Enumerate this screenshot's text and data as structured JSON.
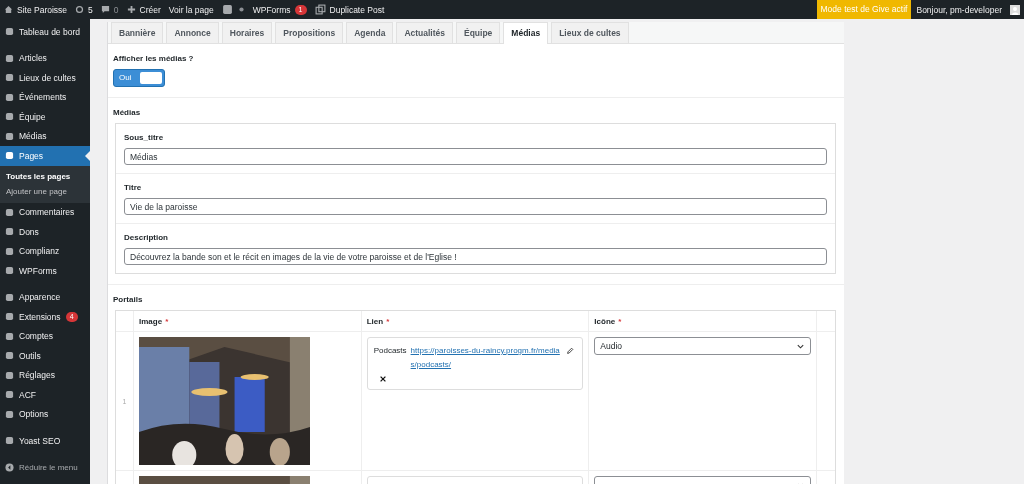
{
  "admin_bar": {
    "site": "Site Paroisse",
    "updates": "5",
    "comments": "0",
    "create": "Créer",
    "view": "Voir la page",
    "wpforms": "WPForms",
    "wpforms_badge": "1",
    "duplicate": "Duplicate Post",
    "give_notice": "Mode test de Give actif",
    "greeting": "Bonjour, pm-developer"
  },
  "sidebar": {
    "groups": [
      [
        {
          "label": "Tableau de bord",
          "selected": false
        }
      ],
      [
        {
          "label": "Articles",
          "selected": false
        },
        {
          "label": "Lieux de cultes",
          "selected": false
        },
        {
          "label": "Événements",
          "selected": false
        },
        {
          "label": "Équipe",
          "selected": false
        },
        {
          "label": "Médias",
          "selected": false
        },
        {
          "label": "Pages",
          "selected": true,
          "children": [
            {
              "label": "Toutes les pages",
              "selected": true
            },
            {
              "label": "Ajouter une page",
              "selected": false
            }
          ]
        },
        {
          "label": "Commentaires",
          "selected": false
        },
        {
          "label": "Dons",
          "selected": false
        },
        {
          "label": "Complianz",
          "selected": false
        },
        {
          "label": "WPForms",
          "selected": false
        }
      ],
      [
        {
          "label": "Apparence",
          "selected": false
        },
        {
          "label": "Extensions",
          "selected": false,
          "badge": "4"
        },
        {
          "label": "Comptes",
          "selected": false
        },
        {
          "label": "Outils",
          "selected": false
        },
        {
          "label": "Réglages",
          "selected": false
        },
        {
          "label": "ACF",
          "selected": false
        },
        {
          "label": "Options",
          "selected": false
        }
      ],
      [
        {
          "label": "Yoast SEO",
          "selected": false
        }
      ]
    ],
    "collapse": "Réduire le menu"
  },
  "tabs": [
    {
      "label": "Bannière",
      "selected": false
    },
    {
      "label": "Annonce",
      "selected": false
    },
    {
      "label": "Horaires",
      "selected": false
    },
    {
      "label": "Propositions",
      "selected": false
    },
    {
      "label": "Agenda",
      "selected": false
    },
    {
      "label": "Actualités",
      "selected": false
    },
    {
      "label": "Équipe",
      "selected": false
    },
    {
      "label": "Médias",
      "selected": true
    },
    {
      "label": "Lieux de cultes",
      "selected": false
    }
  ],
  "show_media": {
    "label": "Afficher les médias ?",
    "on": true,
    "toggle_label": "Oui"
  },
  "media_group": {
    "title": "Médias",
    "fields": [
      {
        "label": "Sous_titre",
        "value": "Médias"
      },
      {
        "label": "Titre",
        "value": "Vie de la paroisse"
      },
      {
        "label": "Description",
        "value": "Découvrez la bande son et le récit en images de la vie de votre paroisse et de l'Eglise !"
      }
    ]
  },
  "portals": {
    "title": "Portails",
    "columns": [
      {
        "label": "Image",
        "required_mark": "*"
      },
      {
        "label": "Lien",
        "required_mark": "*"
      },
      {
        "label": "Icône",
        "required_mark": "*"
      }
    ],
    "rows": [
      {
        "index": "1",
        "image": {
          "kind": "picture"
        },
        "link": {
          "label": "Podcasts",
          "url": "https://paroisses-du-raincy.progm.fr/medias/podcasts/"
        },
        "icon": "Audio"
      },
      {
        "image": {
          "kind": "picture"
        }
      }
    ]
  }
}
